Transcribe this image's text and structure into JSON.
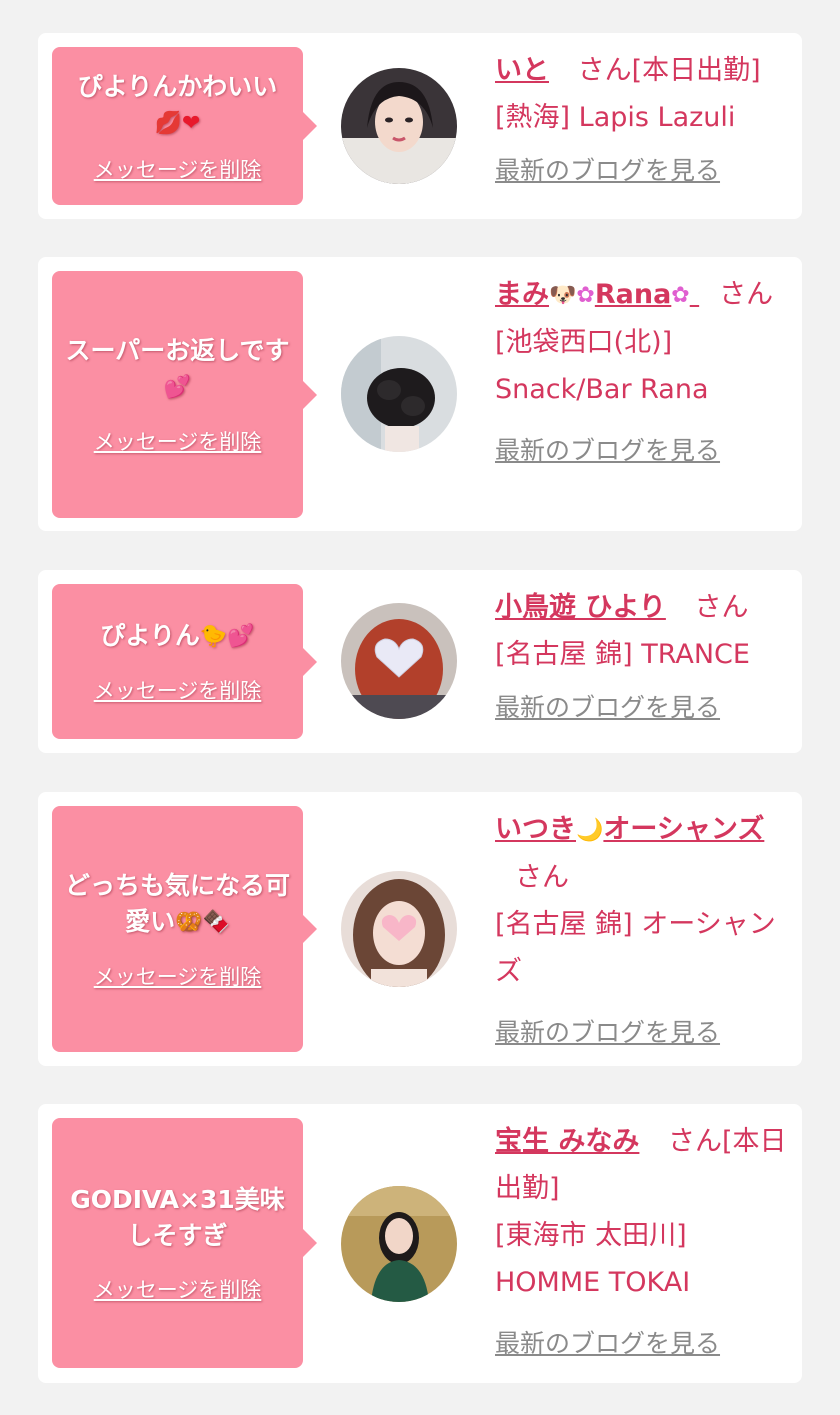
{
  "cards": [
    {
      "message": "ぴよりんかわいい",
      "message_emoji": "💋❤",
      "delete_label": "メッセージを削除",
      "name": "いと",
      "honorific": "さん[本日出勤]",
      "shop": "[熱海] Lapis Lazuli",
      "blog_label": "最新のブログを見る",
      "avatar_icon": "avatar-photo-woman-dark-hair"
    },
    {
      "message": "スーパーお返しです",
      "message_emoji": "💕",
      "delete_label": "メッセージを削除",
      "name_prefix": "まみ",
      "name_emoji_1": "🐶",
      "name_emoji_2": "✿",
      "name_suffix": "Rana",
      "name_emoji_3": "✿",
      "honorific": "さん",
      "shop": "[池袋西口(北)] Snack/Bar Rana",
      "blog_label": "最新のブログを見る",
      "avatar_icon": "avatar-photo-updo-hair"
    },
    {
      "message": "ぴよりん",
      "message_emoji": "🐤💕",
      "delete_label": "メッセージを削除",
      "name": "小鳥遊 ひより",
      "honorific": "さん",
      "shop": "[名古屋 錦] TRANCE",
      "blog_label": "最新のブログを見る",
      "avatar_icon": "avatar-photo-heart-face"
    },
    {
      "message": "どっちも気になる可愛い",
      "message_emoji": "🥨🍫",
      "delete_label": "メッセージを削除",
      "name_prefix": "いつき",
      "name_emoji": "🌙",
      "name_suffix": "オーシャンズ",
      "honorific": "さん",
      "shop": "[名古屋 錦] オーシャンズ",
      "blog_label": "最新のブログを見る",
      "avatar_icon": "avatar-photo-pink-heart-face"
    },
    {
      "message": "GODIVA×31美味しそすぎ",
      "delete_label": "メッセージを削除",
      "name": "宝生 みなみ",
      "honorific": "さん[本日出勤]",
      "shop": "[東海市 太田川] HOMME TOKAI",
      "blog_label": "最新のブログを見る",
      "avatar_icon": "avatar-photo-homme"
    }
  ],
  "colors": {
    "background": "#f2f2f2",
    "bubble": "#fb8fa3",
    "accent": "#d4375e",
    "link_gray": "#8a8a8a"
  }
}
